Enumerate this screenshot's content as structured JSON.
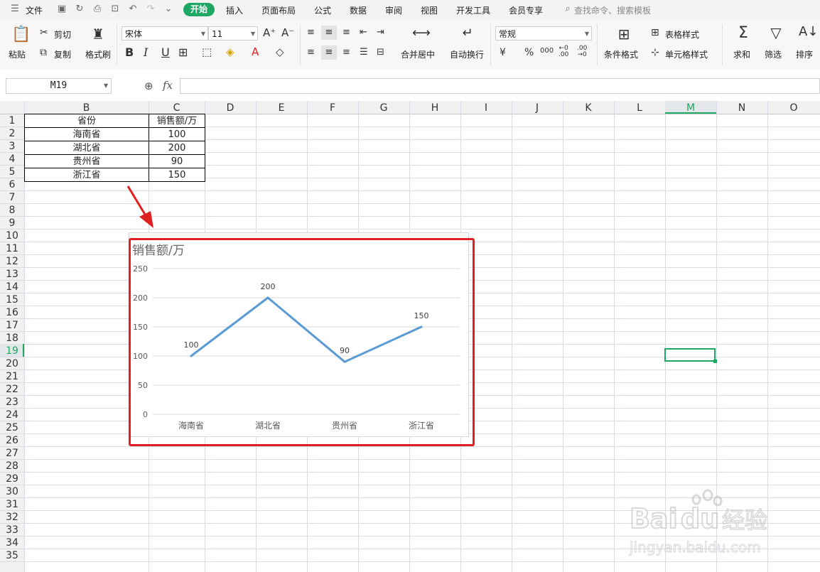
{
  "menu": {
    "file": "文件",
    "tabs": [
      "开始",
      "插入",
      "页面布局",
      "公式",
      "数据",
      "审阅",
      "视图",
      "开发工具",
      "会员专享"
    ],
    "search_placeholder": "查找命令、搜索模板"
  },
  "ribbon": {
    "paste": "粘贴",
    "cut": "剪切",
    "copy": "复制",
    "format_painter": "格式刷",
    "font_name": "宋体",
    "font_size": "11",
    "merge_center": "合并居中",
    "wrap_text": "自动换行",
    "number_format": "常规",
    "conditional_format": "条件格式",
    "table_style": "表格样式",
    "cell_style": "单元格样式",
    "sum": "求和",
    "filter": "筛选",
    "sort": "排序"
  },
  "formula_bar": {
    "name_box": "M19",
    "fx": "fx",
    "content": ""
  },
  "sheet": {
    "columns": [
      "B",
      "C",
      "D",
      "E",
      "F",
      "G",
      "H",
      "I",
      "J",
      "K",
      "L",
      "M",
      "N",
      "O"
    ],
    "active_col": "M",
    "active_row": "19",
    "rows": [
      "1",
      "2",
      "3",
      "4",
      "5",
      "6",
      "7",
      "8",
      "9",
      "10",
      "11",
      "12",
      "13",
      "14",
      "15",
      "16",
      "17",
      "18",
      "19",
      "20",
      "21",
      "22",
      "23",
      "24",
      "25",
      "26",
      "27",
      "28",
      "29",
      "30",
      "31",
      "32",
      "33",
      "34",
      "35"
    ],
    "table_header": {
      "province": "省份",
      "sales": "销售额/万"
    },
    "table_rows": [
      {
        "province": "海南省",
        "sales": "100"
      },
      {
        "province": "湖北省",
        "sales": "200"
      },
      {
        "province": "贵州省",
        "sales": "90"
      },
      {
        "province": "浙江省",
        "sales": "150"
      }
    ]
  },
  "chart_data": {
    "type": "line",
    "title": "销售额/万",
    "categories": [
      "海南省",
      "湖北省",
      "贵州省",
      "浙江省"
    ],
    "series": [
      {
        "values": [
          100,
          200,
          90,
          150
        ]
      }
    ],
    "ylim": [
      0,
      250
    ],
    "yticks": [
      "0",
      "50",
      "100",
      "150",
      "200",
      "250"
    ],
    "grid": true,
    "data_labels": true,
    "line_color": "#5b9bd5"
  },
  "colors": {
    "accent": "#1fa764",
    "highlight_box": "#e02020",
    "arrow": "#e02020"
  },
  "watermark": "Baidu经验 jingyan.baidu.com"
}
